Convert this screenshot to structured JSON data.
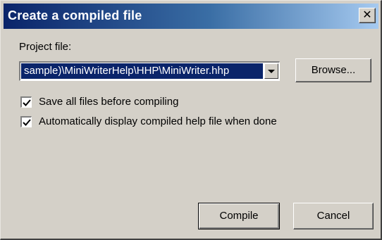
{
  "dialog": {
    "title": "Create a compiled file",
    "close_glyph": "✕"
  },
  "project": {
    "label": "Project file:",
    "value": "sample)\\MiniWriterHelp\\HHP\\MiniWriter.hhp",
    "browse_label": "Browse..."
  },
  "options": [
    {
      "label": "Save all files before compiling",
      "checked": true
    },
    {
      "label": "Automatically display compiled help file when done",
      "checked": true
    }
  ],
  "buttons": {
    "compile_label": "Compile",
    "cancel_label": "Cancel"
  },
  "colors": {
    "face": "#d4d0c8",
    "title_start": "#0a246a",
    "title_end": "#a6caf0",
    "selection": "#0a246a"
  },
  "icons": {
    "close": "close-icon",
    "dropdown": "chevron-down-icon",
    "check": "checkmark-icon"
  }
}
